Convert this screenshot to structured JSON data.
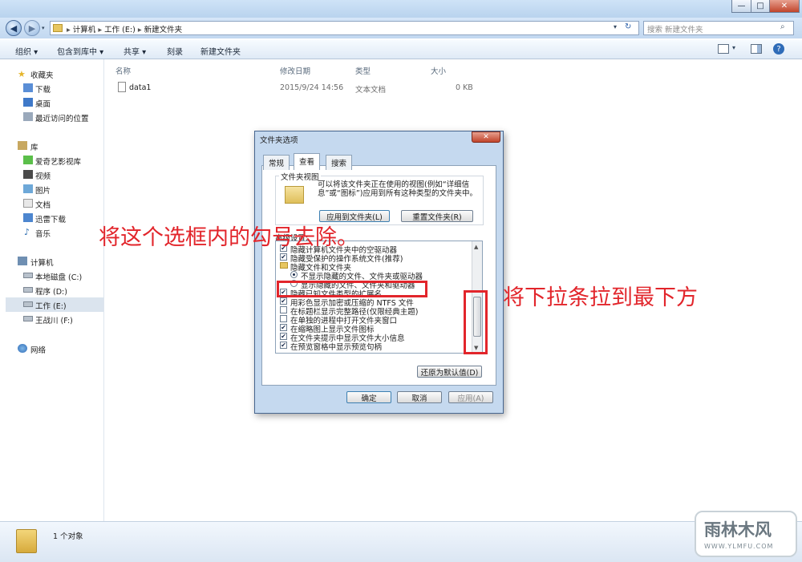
{
  "window": {
    "minimize": "—",
    "maximize": "□",
    "close": "✕"
  },
  "nav": {
    "back": "◀",
    "forward": "▶",
    "breadcrumb": [
      "计算机",
      "工作 (E:)",
      "新建文件夹"
    ],
    "search_placeholder": "搜索 新建文件夹"
  },
  "toolbar": {
    "organize": "组织 ▾",
    "include": "包含到库中 ▾",
    "share": "共享 ▾",
    "burn": "刻录",
    "new_folder": "新建文件夹"
  },
  "sidebar": {
    "favorites": {
      "label": "收藏夹",
      "items": [
        "下载",
        "桌面",
        "最近访问的位置"
      ]
    },
    "libraries": {
      "label": "库",
      "items": [
        "爱奇艺影视库",
        "视频",
        "图片",
        "文档",
        "迅雷下载",
        "音乐"
      ]
    },
    "computer": {
      "label": "计算机",
      "items": [
        "本地磁盘 (C:)",
        "程序 (D:)",
        "工作 (E:)",
        "王战川 (F:)"
      ]
    },
    "network": "网络"
  },
  "list": {
    "columns": [
      "名称",
      "修改日期",
      "类型",
      "大小"
    ],
    "rows": [
      {
        "name": "data1",
        "date": "2015/9/24 14:56",
        "type": "文本文档",
        "size": "0 KB"
      }
    ]
  },
  "status": {
    "count": "1 个对象"
  },
  "dialog": {
    "title": "文件夹选项",
    "tabs": [
      "常规",
      "查看",
      "搜索"
    ],
    "folder_views_group": "文件夹视图",
    "folder_views_desc": "可以将该文件夹正在使用的视图(例如“详细信息”或“图标”)应用到所有这种类型的文件夹中。",
    "apply_btn": "应用到文件夹(L)",
    "reset_btn": "重置文件夹(R)",
    "advanced_label": "高级设置:",
    "options": [
      {
        "label": "隐藏计算机文件夹中的空驱动器",
        "kind": "checkbox",
        "checked": true
      },
      {
        "label": "隐藏受保护的操作系统文件(推荐)",
        "kind": "checkbox",
        "checked": true
      },
      {
        "label": "隐藏文件和文件夹",
        "kind": "folder",
        "checked": false
      },
      {
        "label": "不显示隐藏的文件、文件夹或驱动器",
        "kind": "radio",
        "checked": true
      },
      {
        "label": "显示隐藏的文件、文件夹和驱动器",
        "kind": "radio",
        "checked": false
      },
      {
        "label": "隐藏已知文件类型的扩展名",
        "kind": "checkbox",
        "checked": true
      },
      {
        "label": "用彩色显示加密或压缩的 NTFS 文件",
        "kind": "checkbox",
        "checked": true
      },
      {
        "label": "在标题栏显示完整路径(仅限经典主题)",
        "kind": "checkbox",
        "checked": false
      },
      {
        "label": "在单独的进程中打开文件夹窗口",
        "kind": "checkbox",
        "checked": false
      },
      {
        "label": "在缩略图上显示文件图标",
        "kind": "checkbox",
        "checked": true
      },
      {
        "label": "在文件夹提示中显示文件大小信息",
        "kind": "checkbox",
        "checked": true
      },
      {
        "label": "在预览窗格中显示预览句柄",
        "kind": "checkbox",
        "checked": true
      }
    ],
    "restore_btn": "还原为默认值(D)",
    "ok": "确定",
    "cancel": "取消",
    "apply": "应用(A)"
  },
  "annotations": {
    "left": "将这个选框内的勾号去除。",
    "right": "将下拉条拉到最下方"
  },
  "watermark": {
    "brand": "雨林木风",
    "url": "WWW.YLMFU.COM"
  }
}
